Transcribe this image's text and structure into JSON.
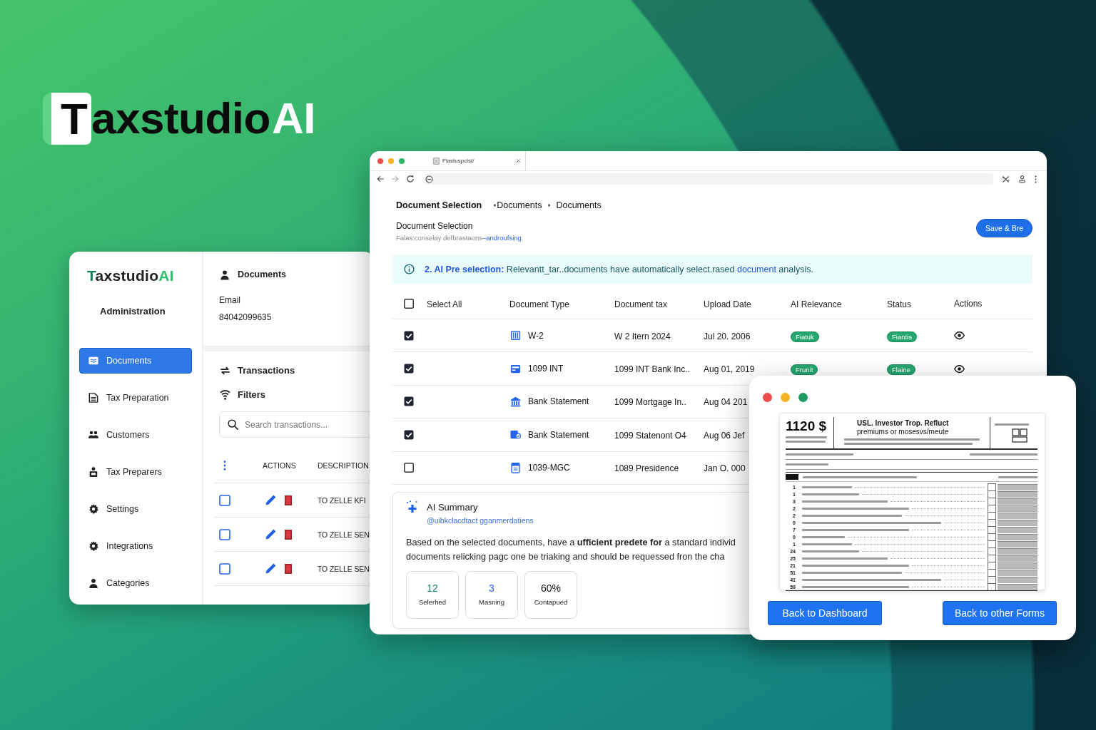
{
  "brand": {
    "lead": "T",
    "name": "axstudio",
    "accent": "AI"
  },
  "admin_panel": {
    "brand": {
      "lead": "T",
      "name": "axstudio",
      "accent": "AI"
    },
    "section": "Administration",
    "nav": [
      {
        "label": "Documents",
        "selected": true
      },
      {
        "label": "Tax Preparation",
        "selected": false
      },
      {
        "label": "Customers",
        "selected": false
      },
      {
        "label": "Tax Preparers",
        "selected": false
      },
      {
        "label": "Settings",
        "selected": false
      },
      {
        "label": "Integrations",
        "selected": false
      },
      {
        "label": "Categories",
        "selected": false
      }
    ],
    "account": {
      "title": "Documents",
      "email_label": "Email",
      "email_value": "84042099635"
    },
    "links": [
      {
        "label": "Transactions"
      },
      {
        "label": "Filters"
      }
    ],
    "search": {
      "placeholder": "Search transactions..."
    },
    "transactions": {
      "columns": [
        "ACTIONS",
        "DESCRIPTION"
      ],
      "rows": [
        {
          "checked": false,
          "description": "TO ZELLE KFI"
        },
        {
          "checked": false,
          "description": "TO ZELLE SEN"
        },
        {
          "checked": false,
          "description": "TO ZELLE SEN"
        }
      ]
    }
  },
  "browser": {
    "tab_title": "Flastuspcist/"
  },
  "document_selection": {
    "title": "Document Selection",
    "breadcrumbs": [
      "Documents",
      "Documents"
    ],
    "heading": "Document Selection",
    "subtitle": "Falas:conselay defbrastaons",
    "subtitle_link": "–androufsing",
    "save_button": "Save & Bre",
    "notice": {
      "title": "2. AI Pre selection:",
      "text": "Relevantt_tar..documents have automatically select.rased",
      "link": "document",
      "text_end": "analysis."
    },
    "table": {
      "select_all": {
        "label": "Select All",
        "checked": false
      },
      "columns": [
        "Document Type",
        "Document tax",
        "Upload Date",
        "AI Relevance",
        "Status",
        "Actions"
      ],
      "rows": [
        {
          "checked": true,
          "document_type": "W-2",
          "document_tax": "W 2 Itern 2024",
          "upload_date": "Jul 20. 2006",
          "ai_relevance": "Fiatuk",
          "status": "Fiantis"
        },
        {
          "checked": true,
          "document_type": "1099 INT",
          "document_tax": "1099 INT Bank Inc..",
          "upload_date": "Aug 01, 2019",
          "ai_relevance": "Frunit",
          "status": "Flaine"
        },
        {
          "checked": true,
          "document_type": "Bank Statement",
          "document_tax": "1099 Mortgage In..",
          "upload_date": "Aug 04 201"
        },
        {
          "checked": true,
          "document_type": "Bank Statement",
          "document_tax": "1099 Statenont O4",
          "upload_date": "Aug 06 Jef"
        },
        {
          "checked": false,
          "document_type": "1039-MGC",
          "document_tax": "1089 Presidence",
          "upload_date": "Jan O. 000"
        }
      ]
    },
    "summary": {
      "title": "AI Summary",
      "subtitle": "@uibkclacdtact gganmerdatiens",
      "text_lines": [
        "Based on the selected documents, have a **ufficient predete for** a standard individ",
        "documents relicking pagc one be triaking and should be requessed fron the cha"
      ],
      "stats": [
        {
          "value": "12",
          "label": "Selerhed",
          "color": "#11806a"
        },
        {
          "value": "3",
          "label": "Masning",
          "color": "#2563eb"
        },
        {
          "value": "60%",
          "label": "Contapued",
          "color": "#111111"
        }
      ]
    }
  },
  "form_preview": {
    "form_number": "1120 $",
    "title": "USL. Investor Trop. Refluct",
    "subtitle": "premiums or mosesvs/meute",
    "line_numbers": [
      "1",
      "1",
      "3",
      "2",
      "2",
      "0",
      "7",
      "0",
      "1",
      "24",
      "25",
      "21",
      "51",
      "41",
      "59"
    ]
  },
  "buttons": [
    "Back to Dashboard",
    "Back to other Forms"
  ]
}
